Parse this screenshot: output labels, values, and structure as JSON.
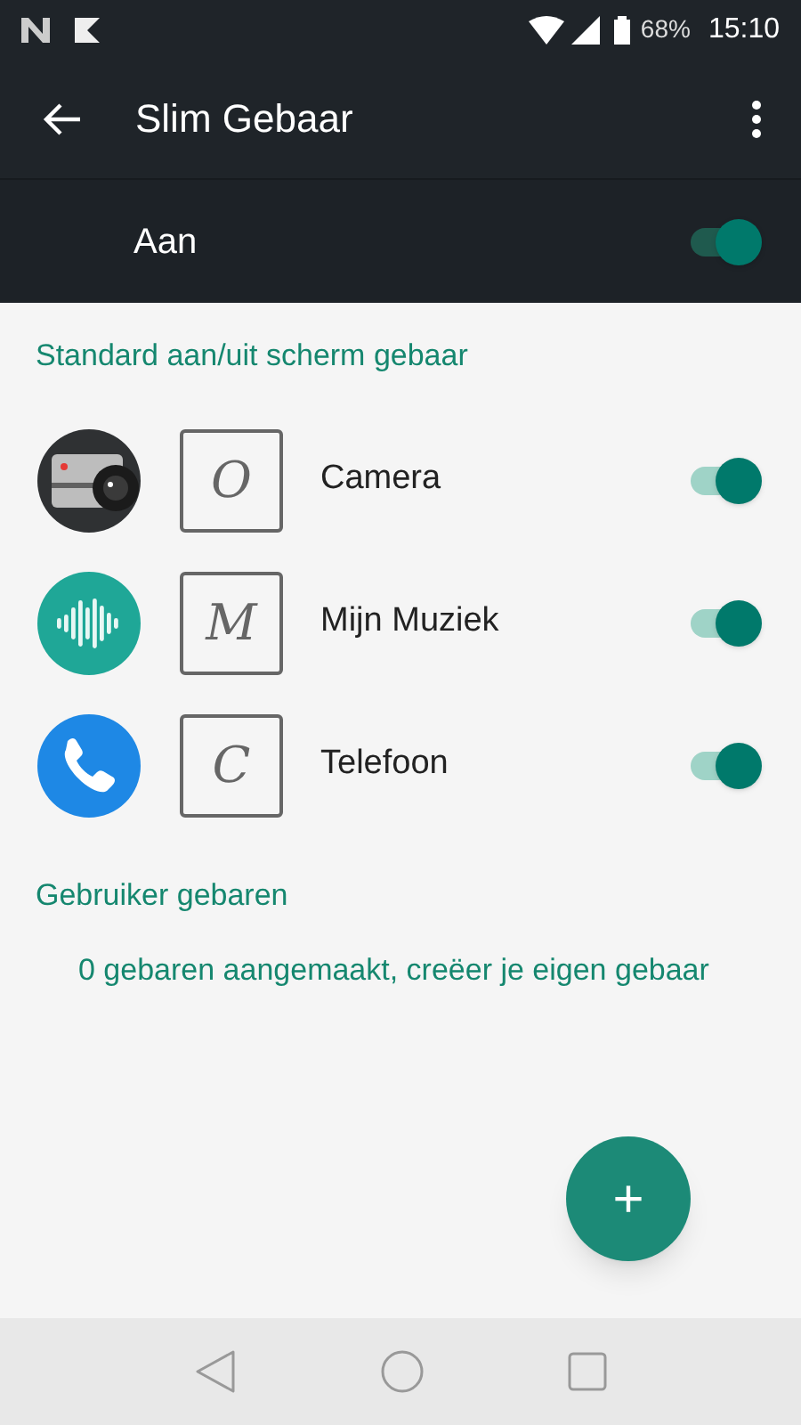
{
  "status_bar": {
    "battery": "68%",
    "time": "15:10"
  },
  "toolbar": {
    "title": "Slim Gebaar"
  },
  "master": {
    "label": "Aan",
    "on": true
  },
  "section_default": {
    "header": "Standard aan/uit scherm gebaar",
    "gestures": [
      {
        "kind": "camera",
        "letter": "O",
        "label": "Camera",
        "on": true
      },
      {
        "kind": "music",
        "letter": "M",
        "label": "Mijn Muziek",
        "on": true
      },
      {
        "kind": "phone",
        "letter": "C",
        "label": "Telefoon",
        "on": true
      }
    ]
  },
  "section_user": {
    "header": "Gebruiker gebaren",
    "message": "0 gebaren aangemaakt, creëer je eigen gebaar"
  },
  "fab": {
    "label": "+"
  }
}
